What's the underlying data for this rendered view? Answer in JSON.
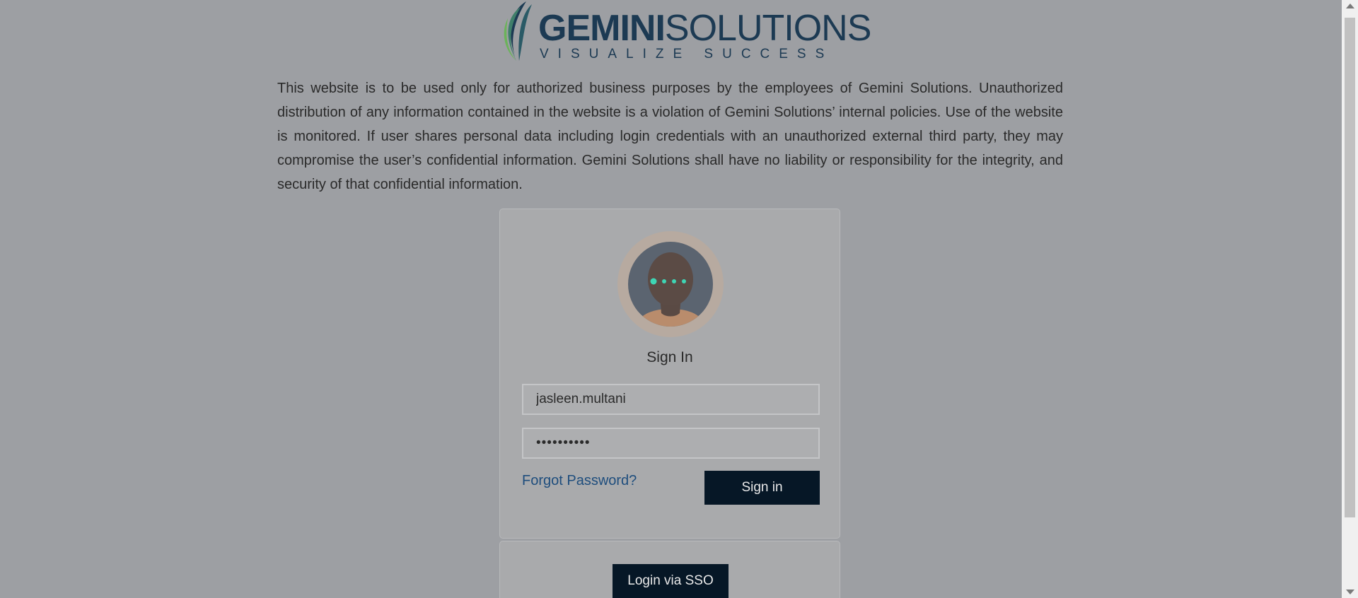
{
  "logo": {
    "brand_bold": "GEMINI",
    "brand_light": "SOLUTIONS",
    "tagline": "VISUALIZE SUCCESS"
  },
  "disclaimer": "This website is to be used only for authorized business purposes by the employees of Gemini Solutions. Unauthorized distribution of any information contained in the website is a violation of Gemini Solutions’ internal policies. Use of the website is monitored. If user shares personal data including login credentials with an unauthorized external third party, they may compromise the user’s confidential information. Gemini Solutions shall have no liability or responsibility for the integrity, and security of that confidential information.",
  "login": {
    "title": "Sign In",
    "username_value": "jasleen.multani",
    "password_value": "••••••••••",
    "forgot_label": "Forgot Password?",
    "signin_label": "Sign in"
  },
  "sso": {
    "button_label": "Login via SSO"
  },
  "colors": {
    "overlay_background": "#9d9fa3",
    "brand_navy": "#1c3a53",
    "button_dark": "#061726",
    "link_blue": "#1e4d7d"
  }
}
